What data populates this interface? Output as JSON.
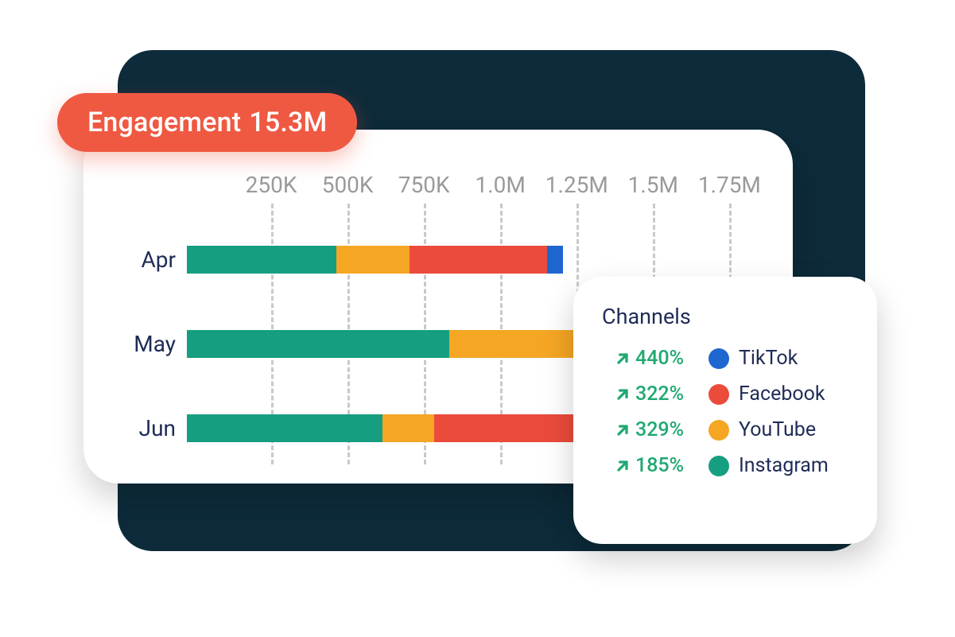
{
  "badge": {
    "label": "Engagement",
    "value": "15.3M"
  },
  "legend": {
    "title": "Channels",
    "items": [
      {
        "name": "TikTok",
        "pct": "440%",
        "color": "#1e66d0"
      },
      {
        "name": "Facebook",
        "pct": "322%",
        "color": "#eb4b3b"
      },
      {
        "name": "YouTube",
        "pct": "329%",
        "color": "#f5a623"
      },
      {
        "name": "Instagram",
        "pct": "185%",
        "color": "#169e80"
      }
    ]
  },
  "chart_data": {
    "type": "bar",
    "orientation": "horizontal",
    "stacked": true,
    "title": "",
    "xlabel": "",
    "ylabel": "",
    "xlim": [
      0,
      1900000
    ],
    "ticks": [
      {
        "v": 250000,
        "label": "250K"
      },
      {
        "v": 500000,
        "label": "500K"
      },
      {
        "v": 750000,
        "label": "750K"
      },
      {
        "v": 1000000,
        "label": "1.0M"
      },
      {
        "v": 1250000,
        "label": "1.25M"
      },
      {
        "v": 1500000,
        "label": "1.5M"
      },
      {
        "v": 1750000,
        "label": "1.75M"
      }
    ],
    "categories": [
      "Apr",
      "May",
      "Jun"
    ],
    "series": [
      {
        "name": "Instagram",
        "color": "#169e80",
        "values": [
          490000,
          860000,
          640000
        ]
      },
      {
        "name": "YouTube",
        "color": "#f5a623",
        "values": [
          240000,
          580000,
          170000
        ]
      },
      {
        "name": "Facebook",
        "color": "#eb4b3b",
        "values": [
          450000,
          50000,
          700000
        ]
      },
      {
        "name": "TikTok",
        "color": "#1e66d0",
        "values": [
          50000,
          0,
          0
        ]
      }
    ],
    "legend_position": "right",
    "grid": true
  }
}
